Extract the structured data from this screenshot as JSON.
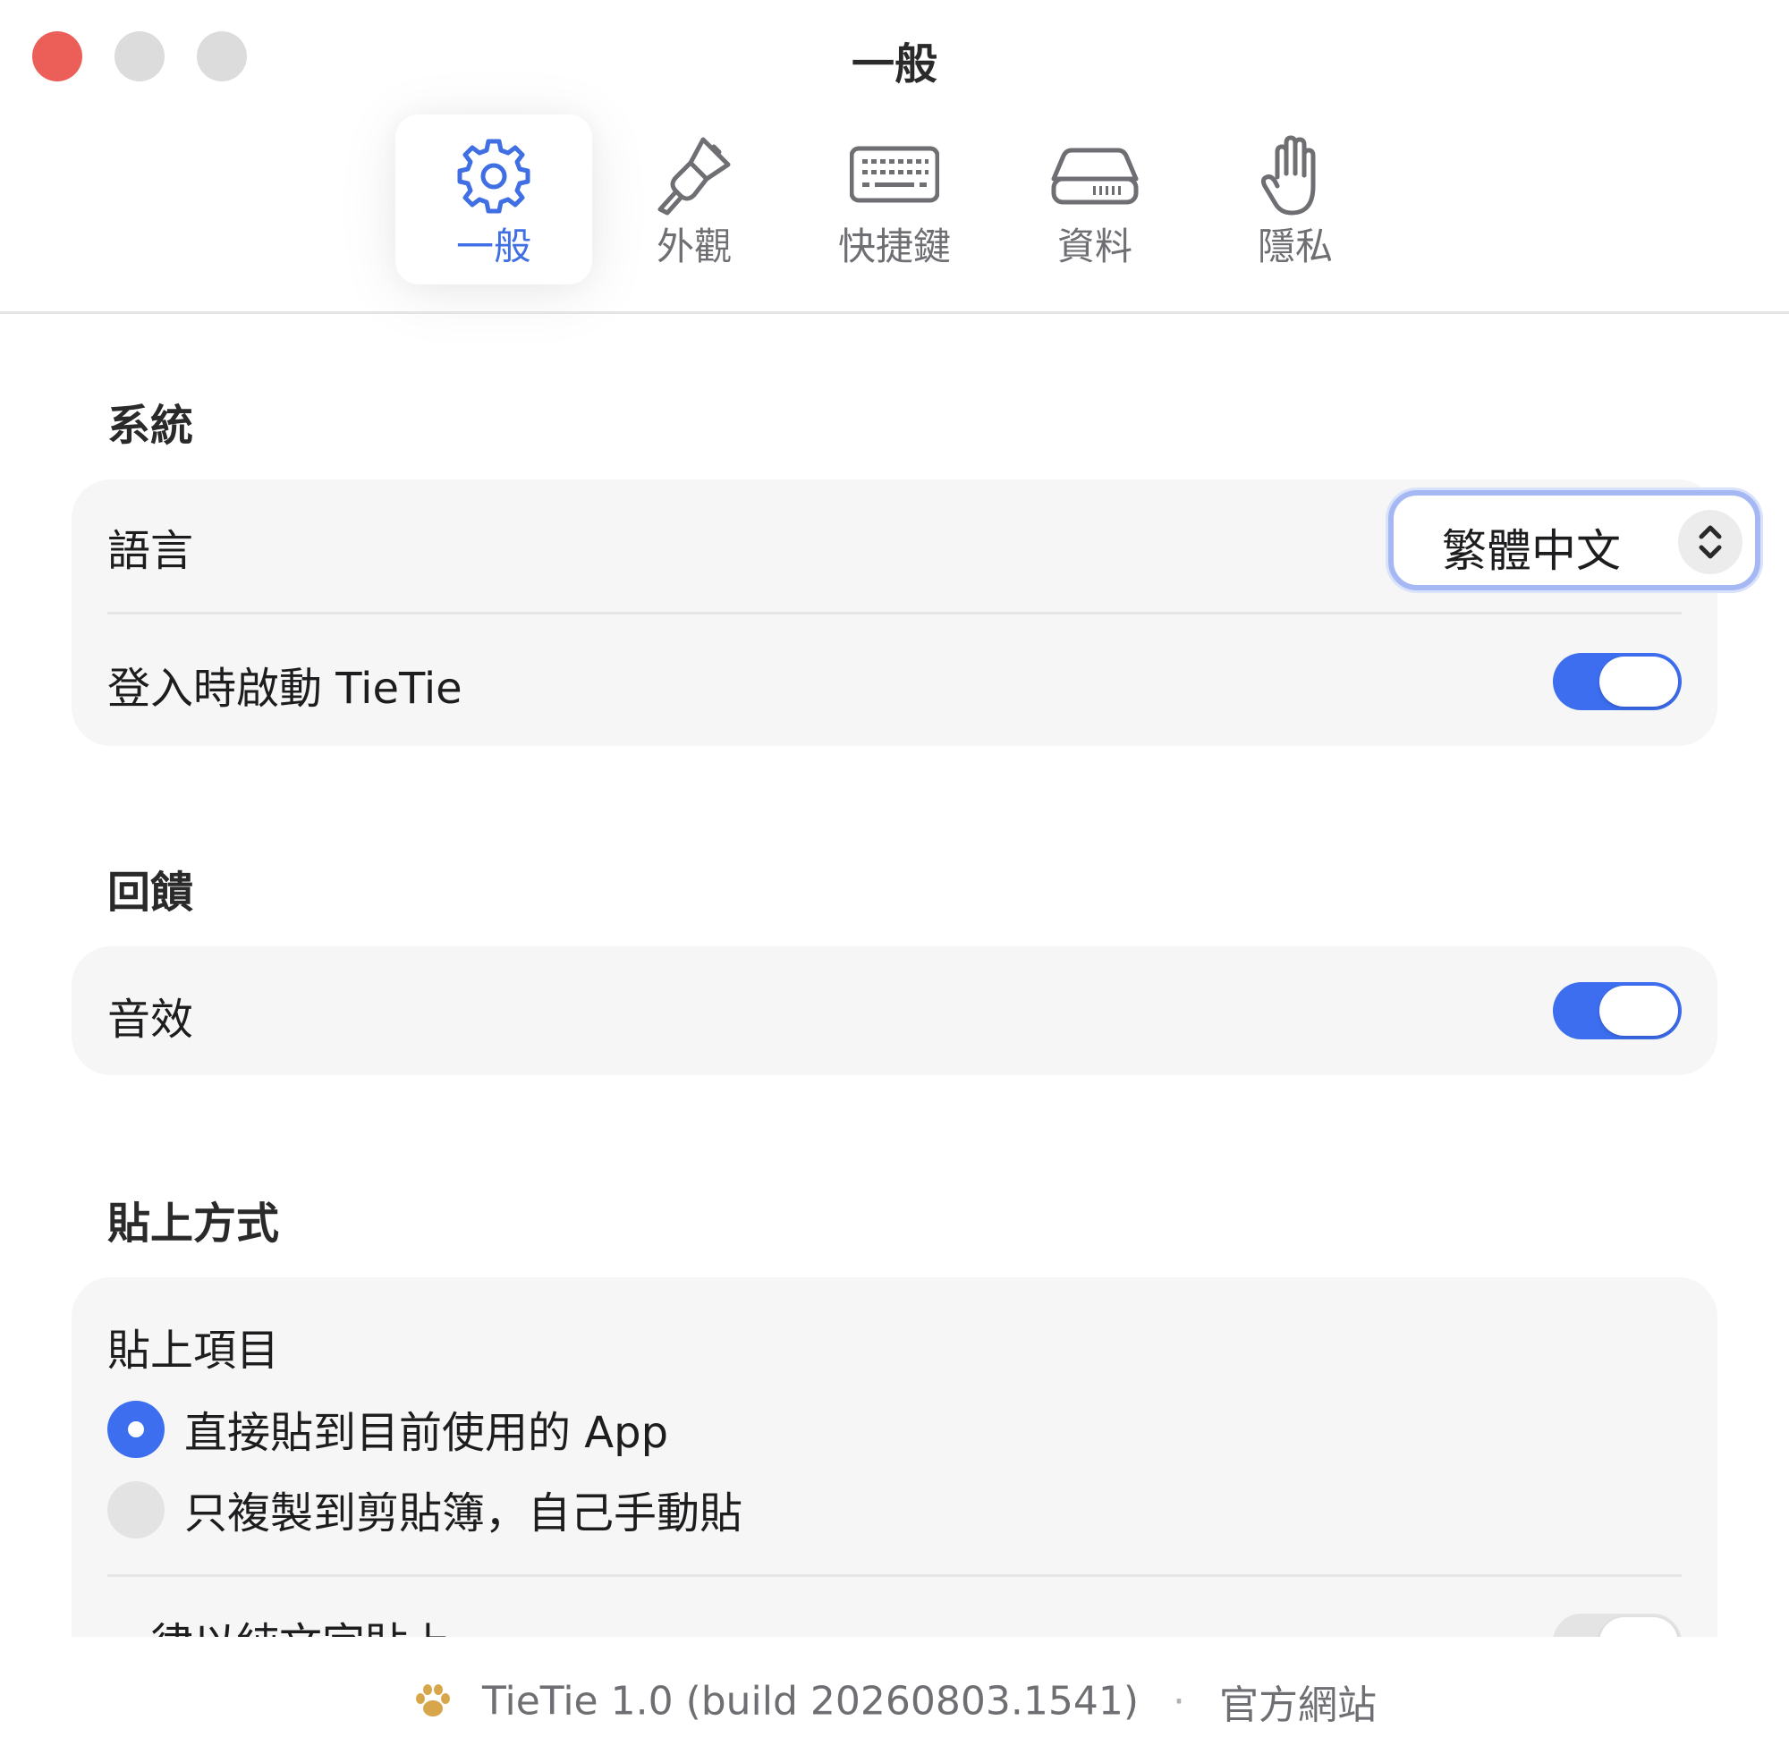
{
  "window": {
    "title": "一般"
  },
  "toolbar": {
    "tabs": [
      {
        "label": "一般",
        "icon": "gear-icon",
        "active": true
      },
      {
        "label": "外觀",
        "icon": "paintbrush-icon",
        "active": false
      },
      {
        "label": "快捷鍵",
        "icon": "keyboard-icon",
        "active": false
      },
      {
        "label": "資料",
        "icon": "drive-icon",
        "active": false
      },
      {
        "label": "隱私",
        "icon": "hand-icon",
        "active": false
      }
    ]
  },
  "sections": {
    "system": {
      "title": "系統",
      "language_label": "語言",
      "language_value": "繁體中文",
      "launch_label": "登入時啟動 TieTie",
      "launch_on": true
    },
    "feedback": {
      "title": "回饋",
      "sound_label": "音效",
      "sound_on": true
    },
    "paste": {
      "title": "貼上方式",
      "item_label": "貼上項目",
      "options": [
        {
          "label": "直接貼到目前使用的 App",
          "selected": true
        },
        {
          "label": "只複製到剪貼簿，自己手動貼",
          "selected": false
        }
      ],
      "plain_text_label": "一律以純文字貼上",
      "plain_text_on": false
    }
  },
  "footer": {
    "version": "TieTie 1.0 (build 20260803.1541)",
    "separator": "·",
    "website_link": "官方網站"
  },
  "colors": {
    "accent": "#3d6ef0",
    "close": "#ec5f59",
    "card_bg": "#f6f6f6",
    "paw": "#d8a64a"
  }
}
